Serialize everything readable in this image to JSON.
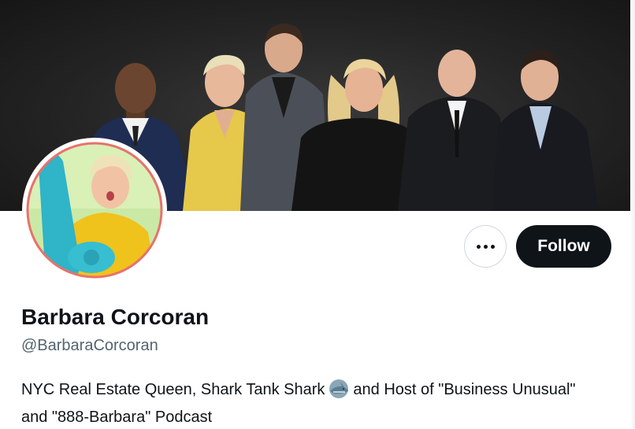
{
  "profile": {
    "display_name": "Barbara Corcoran",
    "handle": "@BarbaraCorcoran",
    "bio_part1": "NYC Real Estate Queen, Shark Tank Shark",
    "bio_emoji": "shark-emoji",
    "bio_part2": "and Host of \"Business Unusual\" and \"888-Barbara\" Podcast"
  },
  "actions": {
    "more_icon": "more-icon",
    "follow_label": "Follow"
  },
  "colors": {
    "follow_bg": "#0f1419",
    "avatar_ring": "#e8726b",
    "handle_text": "#536471"
  }
}
